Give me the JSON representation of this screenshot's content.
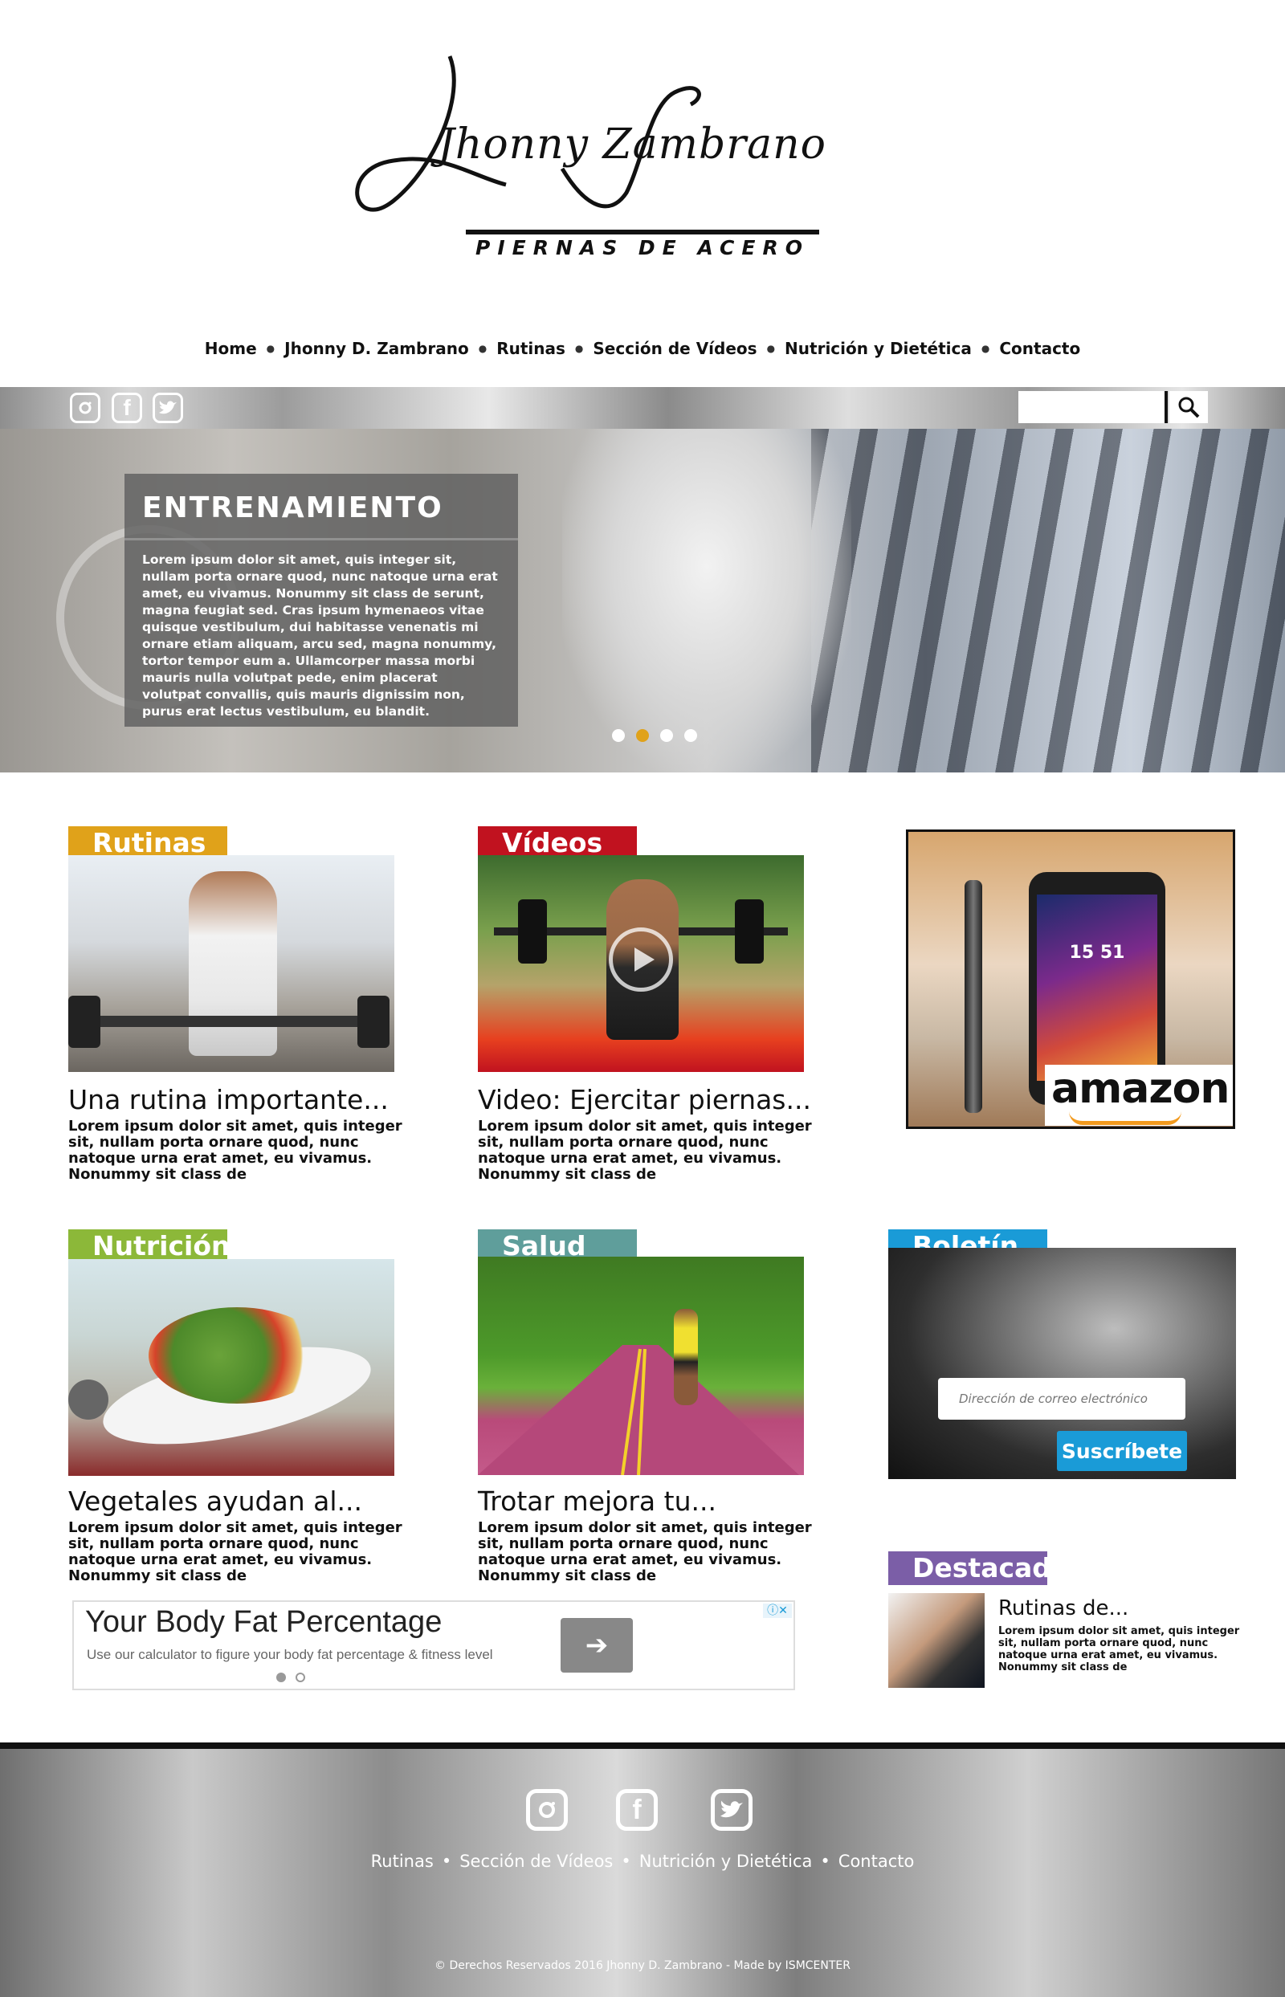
{
  "logo": {
    "name": "Jhonny Zambrano",
    "tagline": "PIERNAS DE ACERO"
  },
  "nav": {
    "items": [
      "Home",
      "Jhonny D. Zambrano",
      "Rutinas",
      "Sección de Vídeos",
      "Nutrición y Dietética",
      "Contacto"
    ]
  },
  "social": {
    "instagram": "instagram-icon",
    "facebook": "facebook-icon",
    "twitter": "twitter-icon"
  },
  "hero": {
    "title": "ENTRENAMIENTO",
    "text": "Lorem ipsum dolor sit amet, quis integer sit, nullam porta ornare quod, nunc natoque urna erat amet, eu vivamus. Nonummy sit class de serunt, magna feugiat sed. Cras ipsum hymenaeos vitae quisque vestibulum, dui habitasse venenatis mi ornare etiam aliquam, arcu sed, magna nonummy, tortor tempor eum a. Ullamcorper massa morbi mauris nulla volutpat pede, enim placerat volutpat convallis, quis mauris dignissim non, purus erat lectus vestibulum, eu blandit."
  },
  "cards": [
    {
      "tab": "Rutinas",
      "color": "#e0a21a",
      "title": "Una rutina importante...",
      "text": "Lorem ipsum dolor sit amet, quis integer sit, nullam porta ornare quod, nunc natoque urna erat amet, eu vivamus. Nonummy sit class de"
    },
    {
      "tab": "Vídeos",
      "color": "#c1121f",
      "title": "Video: Ejercitar piernas...",
      "text": "Lorem ipsum dolor sit amet, quis integer sit, nullam porta ornare quod, nunc natoque urna erat amet, eu vivamus. Nonummy sit class de"
    },
    {
      "tab": "Nutrición",
      "color": "#8cb839",
      "title": "Vegetales ayudan al...",
      "text": "Lorem ipsum dolor sit amet, quis integer sit, nullam porta ornare quod, nunc natoque urna erat amet, eu vivamus. Nonummy sit class de"
    },
    {
      "tab": "Salud",
      "color": "#5f9e9b",
      "title": "Trotar mejora tu...",
      "text": "Lorem ipsum dolor sit amet, quis integer sit, nullam porta ornare quod, nunc natoque urna erat amet, eu vivamus. Nonummy sit class de"
    }
  ],
  "amazon": {
    "brand": "amazon",
    "clock": "15 51"
  },
  "newsletter": {
    "tab": "Boletín",
    "color": "#1a9bd7",
    "placeholder": "Dirección de correo electrónico",
    "button": "Suscríbete"
  },
  "featured": {
    "tab": "Destacado",
    "color": "#7b5ea7",
    "title": "Rutinas de...",
    "text": "Lorem ipsum dolor sit amet, quis integer sit, nullam porta ornare quod, nunc natoque urna erat amet, eu vivamus. Nonummy sit class de"
  },
  "ad": {
    "headline": "Your Body Fat Percentage",
    "subtext": "Use our calculator to figure your body fat percentage & fitness level",
    "button_icon": "arrow-right-icon"
  },
  "footer": {
    "nav": [
      "Rutinas",
      "Sección de Vídeos",
      "Nutrición y Dietética",
      "Contacto"
    ],
    "copyright": "© Derechos Reservados 2016 Jhonny D. Zambrano - Made by ISMCENTER"
  }
}
